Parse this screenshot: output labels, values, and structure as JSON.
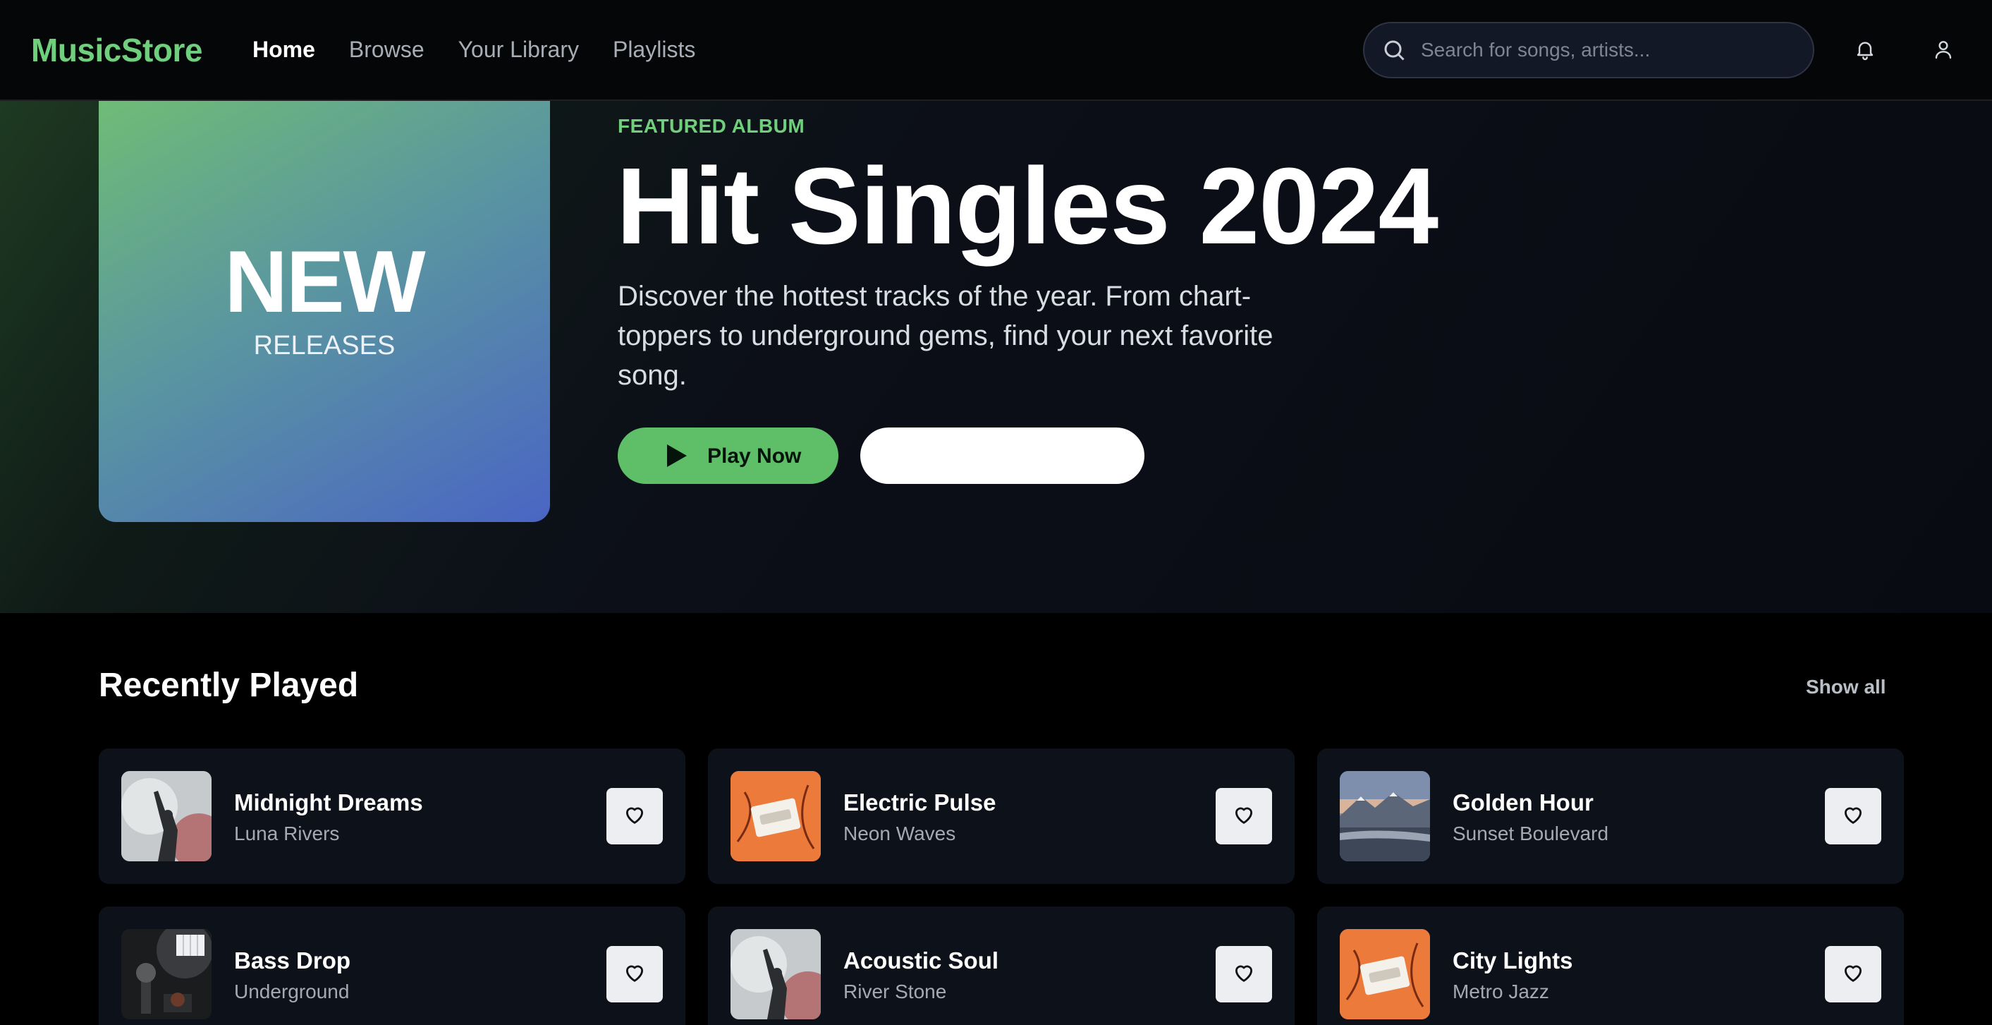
{
  "nav": {
    "logo": "MusicStore",
    "links": [
      "Home",
      "Browse",
      "Your Library",
      "Playlists"
    ],
    "active_index": 0,
    "search_placeholder": "Search for songs, artists..."
  },
  "hero": {
    "art_big": "NEW",
    "art_small": "RELEASES",
    "eyebrow": "FEATURED ALBUM",
    "title": "Hit Singles 2024",
    "description": "Discover the hottest tracks of the year. From chart-toppers to underground gems, find your next favorite song.",
    "play_label": "Play Now",
    "secondary_label": ""
  },
  "recent": {
    "title": "Recently Played",
    "show_all": "Show all",
    "tracks": [
      {
        "title": "Midnight Dreams",
        "artist": "Luna Rivers",
        "thumb": "concert"
      },
      {
        "title": "Electric Pulse",
        "artist": "Neon Waves",
        "thumb": "cassette"
      },
      {
        "title": "Golden Hour",
        "artist": "Sunset Boulevard",
        "thumb": "mountain"
      },
      {
        "title": "Bass Drop",
        "artist": "Underground",
        "thumb": "studio"
      },
      {
        "title": "Acoustic Soul",
        "artist": "River Stone",
        "thumb": "concert"
      },
      {
        "title": "City Lights",
        "artist": "Metro Jazz",
        "thumb": "cassette"
      }
    ]
  },
  "colors": {
    "accent": "#6fcf7d",
    "play_button": "#5fbf69",
    "card_bg": "#0d1119"
  }
}
